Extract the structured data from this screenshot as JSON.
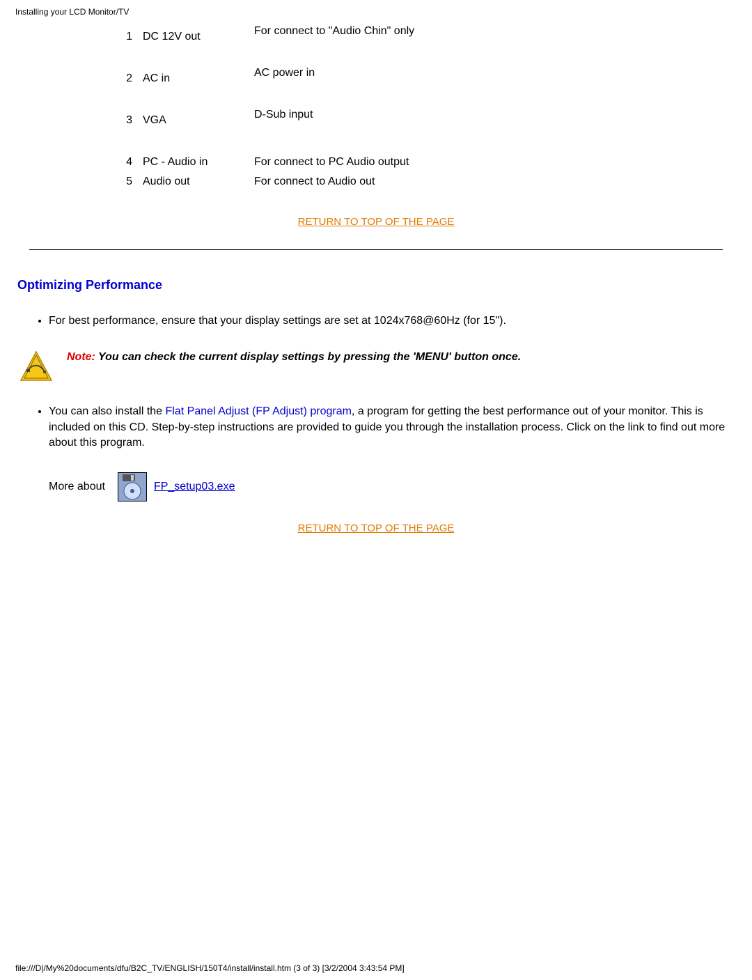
{
  "header_title": "Installing your LCD Monitor/TV",
  "connections": [
    {
      "num": "1",
      "label": "DC 12V out",
      "desc": "For connect to \"Audio Chin\" only"
    },
    {
      "num": "2",
      "label": "AC in",
      "desc": "AC power in"
    },
    {
      "num": "3",
      "label": "VGA",
      "desc": "D-Sub input"
    },
    {
      "num": "4",
      "label": "PC - Audio in",
      "desc": "For connect to PC Audio output"
    },
    {
      "num": "5",
      "label": "Audio out",
      "desc": "For connect to Audio out"
    }
  ],
  "return_top": "RETURN TO TOP OF THE PAGE",
  "section_title": "Optimizing Performance",
  "bullet1": "For best performance, ensure that your display settings are set at 1024x768@60Hz (for 15\").",
  "note_prefix": "Note: ",
  "note_body": "You can check the current display settings by pressing the 'MENU' button once.",
  "bullet2_pre": "You can also install the ",
  "bullet2_link": "Flat Panel Adjust (FP Adjust) program",
  "bullet2_post": ", a program for getting the best performance out of your monitor. This is included on this CD. Step-by-step instructions are provided to guide you through the installation process. Click on the link to find out more about this program.",
  "more_about": "More about",
  "fp_link": "FP_setup03.exe",
  "footer": "file:///D|/My%20documents/dfu/B2C_TV/ENGLISH/150T4/install/install.htm (3 of 3) [3/2/2004 3:43:54 PM]"
}
